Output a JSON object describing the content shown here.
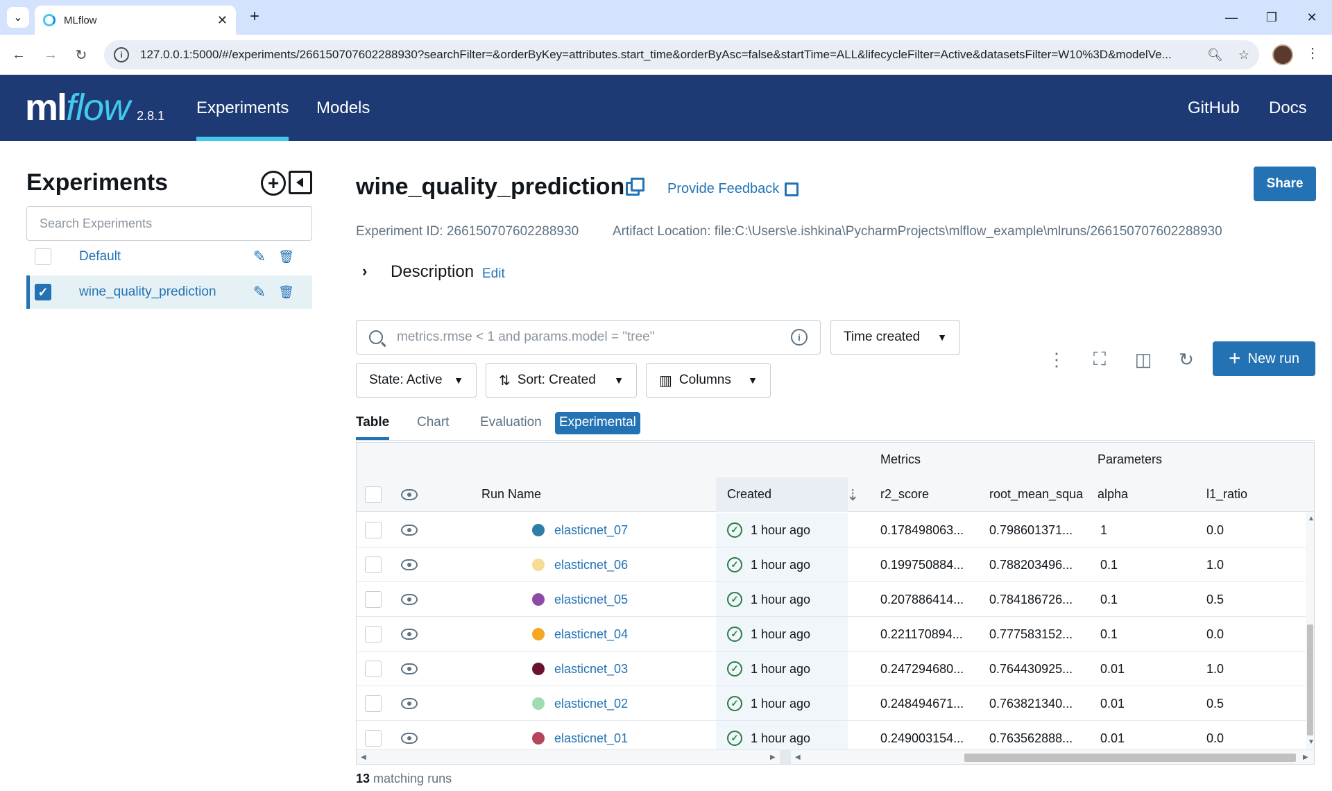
{
  "browser": {
    "tab_title": "MLflow",
    "url": "127.0.0.1:5000/#/experiments/266150707602288930?searchFilter=&orderByKey=attributes.start_time&orderByAsc=false&startTime=ALL&lifecycleFilter=Active&datasetsFilter=W10%3D&modelVe..."
  },
  "app": {
    "logo_ml": "ml",
    "logo_flow": "flow",
    "version": "2.8.1",
    "nav": [
      "Experiments",
      "Models"
    ],
    "nav_right": [
      "GitHub",
      "Docs"
    ]
  },
  "sidebar": {
    "title": "Experiments",
    "search_placeholder": "Search Experiments",
    "experiments": [
      {
        "name": "Default",
        "checked": false
      },
      {
        "name": "wine_quality_prediction",
        "checked": true
      }
    ]
  },
  "experiment": {
    "title": "wine_quality_prediction",
    "feedback": "Provide Feedback",
    "share": "Share",
    "id_line": "Experiment ID: 266150707602288930",
    "artifact_line": "Artifact Location: file:C:\\Users\\e.ishkina\\PycharmProjects\\mlflow_example\\mlruns/266150707602288930",
    "description_label": "Description",
    "description_edit": "Edit"
  },
  "controls": {
    "search_placeholder": "metrics.rmse < 1 and params.model = \"tree\"",
    "time_created": "Time created",
    "state": "State: Active",
    "sort": "Sort: Created",
    "columns": "Columns",
    "new_run": "New run"
  },
  "view_tabs": [
    "Table",
    "Chart",
    "Evaluation",
    "Experimental"
  ],
  "table": {
    "group_metrics": "Metrics",
    "group_parameters": "Parameters",
    "headers": {
      "run_name": "Run Name",
      "created": "Created",
      "r2": "r2_score",
      "rmse": "root_mean_squa",
      "alpha": "alpha",
      "l1": "l1_ratio"
    },
    "rows": [
      {
        "name": "elasticnet_07",
        "color": "#2f7ea8",
        "created": "1 hour ago",
        "r2": "0.178498063...",
        "rmse": "0.798601371...",
        "alpha": "1",
        "l1": "0.0"
      },
      {
        "name": "elasticnet_06",
        "color": "#f5dc94",
        "created": "1 hour ago",
        "r2": "0.199750884...",
        "rmse": "0.788203496...",
        "alpha": "0.1",
        "l1": "1.0"
      },
      {
        "name": "elasticnet_05",
        "color": "#8e4aa8",
        "created": "1 hour ago",
        "r2": "0.207886414...",
        "rmse": "0.784186726...",
        "alpha": "0.1",
        "l1": "0.5"
      },
      {
        "name": "elasticnet_04",
        "color": "#f5a623",
        "created": "1 hour ago",
        "r2": "0.221170894...",
        "rmse": "0.777583152...",
        "alpha": "0.1",
        "l1": "0.0"
      },
      {
        "name": "elasticnet_03",
        "color": "#6b1232",
        "created": "1 hour ago",
        "r2": "0.247294680...",
        "rmse": "0.764430925...",
        "alpha": "0.01",
        "l1": "1.0"
      },
      {
        "name": "elasticnet_02",
        "color": "#9fdcb3",
        "created": "1 hour ago",
        "r2": "0.248494671...",
        "rmse": "0.763821340...",
        "alpha": "0.01",
        "l1": "0.5"
      },
      {
        "name": "elasticnet_01",
        "color": "#b5455b",
        "created": "1 hour ago",
        "r2": "0.249003154...",
        "rmse": "0.763562888...",
        "alpha": "0.01",
        "l1": "0.0"
      }
    ]
  },
  "footer": {
    "count": "13",
    "label": " matching runs"
  }
}
